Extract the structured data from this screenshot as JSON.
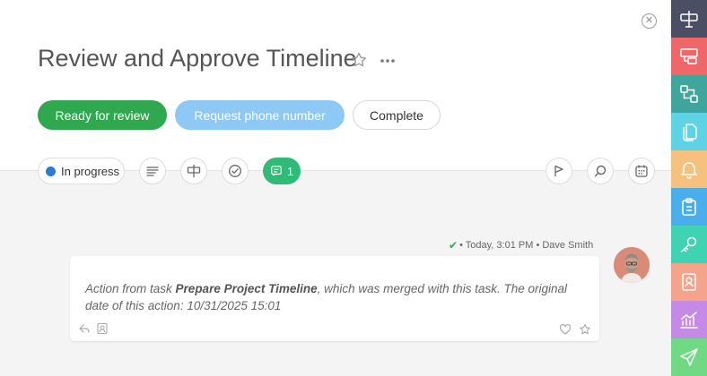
{
  "task": {
    "title": "Review and Approve Timeline"
  },
  "actions": {
    "ready_label": "Ready for review",
    "request_label": "Request phone number",
    "complete_label": "Complete"
  },
  "toolbar": {
    "status_label": "In progress",
    "comment_count": "1"
  },
  "comment": {
    "meta_text": "• Today, 3:01 PM • Dave Smith",
    "prefix": "Action from task ",
    "task_name": "Prepare Project Timeline",
    "suffix": ", which was merged with this task. The original date of this action: 10/31/2025 15:01"
  },
  "colors": {
    "ready": "#2fa84f",
    "request": "#8ec9f5",
    "status_dot": "#2e7bd6",
    "comment_badge": "#2fba77",
    "rail": [
      "#4a4f63",
      "#f0676a",
      "#3fa59d",
      "#5fd3e6",
      "#f6c07d",
      "#4aaeea",
      "#3fd3b3",
      "#f5a38b",
      "#c48ae6",
      "#6fd983"
    ]
  },
  "icons": {
    "rail": [
      "sign-post-icon",
      "window-link-icon",
      "flow-icon",
      "documents-icon",
      "bell-icon",
      "clipboard-icon",
      "key-icon",
      "contact-icon",
      "chart-icon",
      "send-icon"
    ]
  }
}
